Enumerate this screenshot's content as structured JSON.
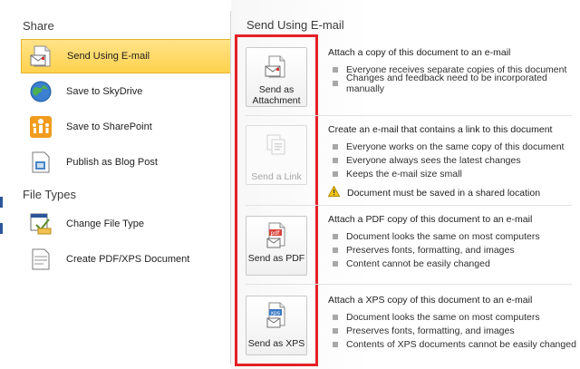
{
  "left": {
    "share_title": "Share",
    "file_types_title": "File Types",
    "share_items": [
      {
        "label": "Send Using E-mail",
        "icon": "email-icon",
        "selected": true
      },
      {
        "label": "Save to SkyDrive",
        "icon": "globe-icon",
        "selected": false
      },
      {
        "label": "Save to SharePoint",
        "icon": "sharepoint-icon",
        "selected": false
      },
      {
        "label": "Publish as Blog Post",
        "icon": "blog-icon",
        "selected": false
      }
    ],
    "file_type_items": [
      {
        "label": "Change File Type",
        "icon": "change-file-type-icon"
      },
      {
        "label": "Create PDF/XPS Document",
        "icon": "pdf-xps-document-icon"
      }
    ]
  },
  "right": {
    "title": "Send Using E-mail",
    "options": [
      {
        "button_label": "Send as Attachment",
        "icon": "email-attachment-icon",
        "enabled": true,
        "description": "Attach a copy of this document to an e-mail",
        "bullets": [
          "Everyone receives separate copies of this document",
          "Changes and feedback need to be incorporated manually"
        ]
      },
      {
        "button_label": "Send a Link",
        "icon": "send-link-icon",
        "enabled": false,
        "description": "Create an e-mail that contains a link to this document",
        "bullets": [
          "Everyone works on the same copy of this document",
          "Everyone always sees the latest changes",
          "Keeps the e-mail size small"
        ],
        "warning": "Document must be saved in a shared location"
      },
      {
        "button_label": "Send as PDF",
        "icon": "pdf-icon",
        "enabled": true,
        "description": "Attach a PDF copy of this document to an e-mail",
        "bullets": [
          "Document looks the same on most computers",
          "Preserves fonts, formatting, and images",
          "Content cannot be easily changed"
        ]
      },
      {
        "button_label": "Send as XPS",
        "icon": "xps-icon",
        "enabled": true,
        "description": "Attach a XPS copy of this document to an e-mail",
        "bullets": [
          "Document looks the same on most computers",
          "Preserves fonts, formatting, and images",
          "Contents of XPS documents cannot be easily changed"
        ]
      }
    ]
  },
  "colors": {
    "selected_bg": "#ffd24d",
    "highlight_box": "#e32127",
    "accent": "#2b579a"
  }
}
